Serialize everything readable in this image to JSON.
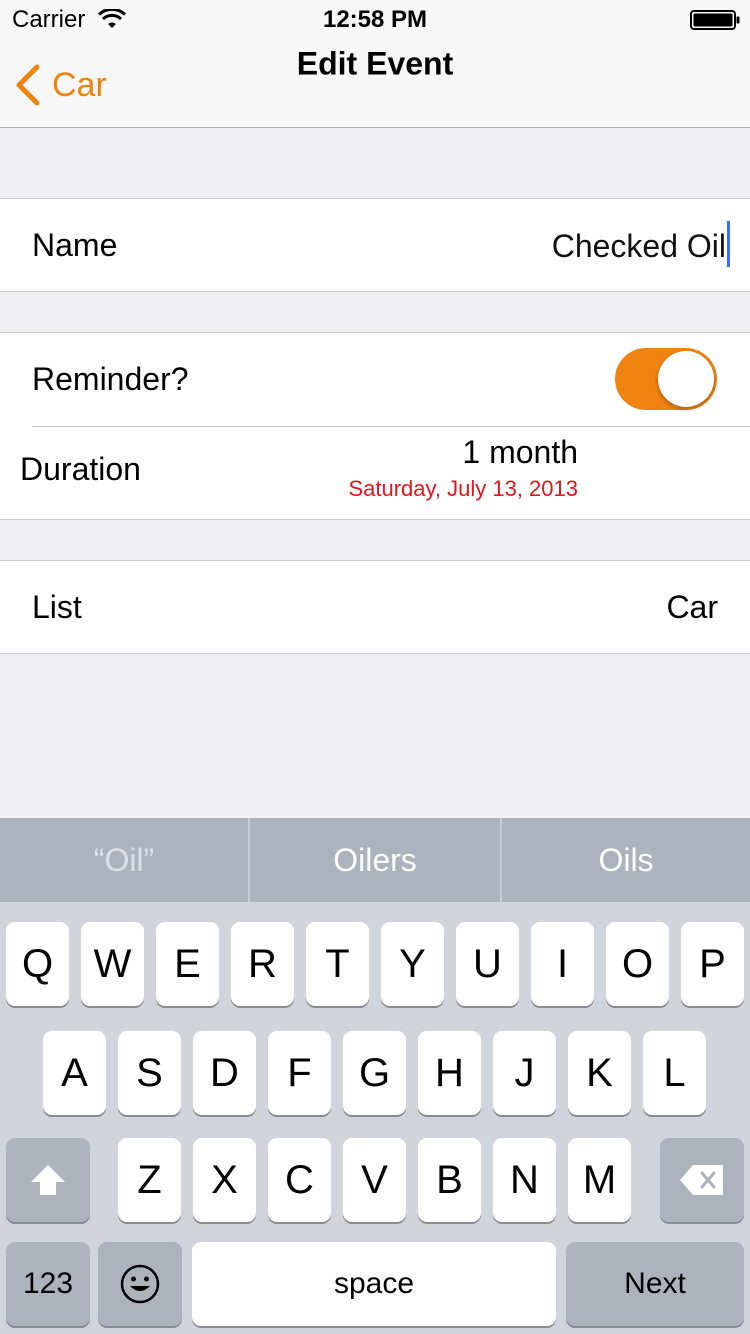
{
  "status_bar": {
    "carrier": "Carrier",
    "time": "12:58 PM"
  },
  "nav": {
    "back_label": "Car",
    "title": "Edit Event"
  },
  "form": {
    "name_label": "Name",
    "name_value": "Checked Oil",
    "reminder_label": "Reminder?",
    "reminder_on": true,
    "duration_label": "Duration",
    "duration_value": "1 month",
    "duration_date": "Saturday, July 13, 2013",
    "list_label": "List",
    "list_value": "Car"
  },
  "colors": {
    "accent": "#f0830f",
    "date_red": "#e3151a",
    "caret": "#3a6ff7"
  },
  "keyboard": {
    "suggestions": [
      "“Oil”",
      "Oilers",
      "Oils"
    ],
    "row1": [
      "Q",
      "W",
      "E",
      "R",
      "T",
      "Y",
      "U",
      "I",
      "O",
      "P"
    ],
    "row2": [
      "A",
      "S",
      "D",
      "F",
      "G",
      "H",
      "J",
      "K",
      "L"
    ],
    "row3": [
      "Z",
      "X",
      "C",
      "V",
      "B",
      "N",
      "M"
    ],
    "numbers_label": "123",
    "space_label": "space",
    "next_label": "Next"
  }
}
